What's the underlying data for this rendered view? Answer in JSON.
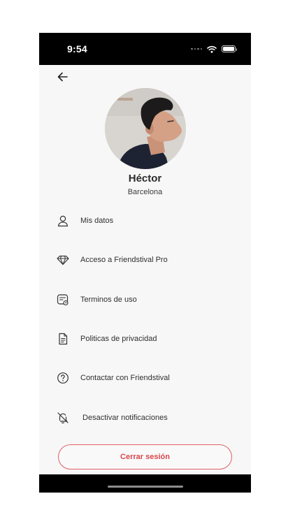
{
  "status_bar": {
    "time": "9:54",
    "icons": [
      "signal-dots-icon",
      "wifi-icon",
      "battery-icon"
    ]
  },
  "header": {
    "back_icon": "arrow-left-icon"
  },
  "profile": {
    "name": "Héctor",
    "city": "Barcelona",
    "avatar": "profile-photo"
  },
  "menu": [
    {
      "id": "mis-datos",
      "icon": "user-icon",
      "label": "Mis datos"
    },
    {
      "id": "acceso-pro",
      "icon": "diamond-icon",
      "label": "Acceso a Friendstival Pro"
    },
    {
      "id": "terminos",
      "icon": "terms-document-icon",
      "label": "Terminos de uso"
    },
    {
      "id": "privacidad",
      "icon": "file-text-icon",
      "label": "Politicas de privacidad"
    },
    {
      "id": "contactar",
      "icon": "help-circle-icon",
      "label": "Contactar con Friendstival"
    },
    {
      "id": "notificaciones",
      "icon": "bell-off-icon",
      "label": " Desactivar notificaciones"
    }
  ],
  "logout": {
    "label": "Cerrar sesión"
  },
  "colors": {
    "accent": "#d9474d",
    "background": "#f7f7f7",
    "text": "#2f2f2f"
  }
}
